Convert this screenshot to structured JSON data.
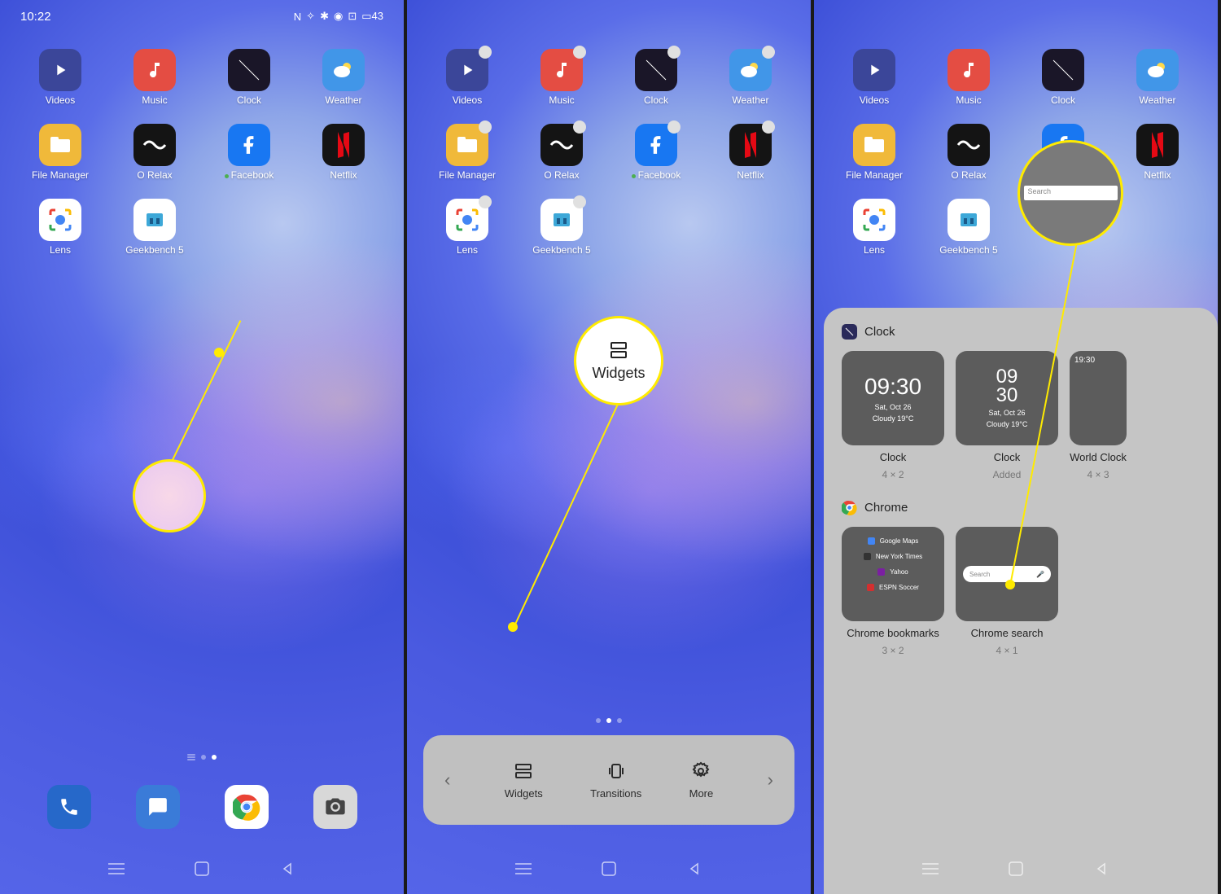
{
  "statusbar": {
    "time": "10:22",
    "battery": "43"
  },
  "apps": {
    "videos": "Videos",
    "music": "Music",
    "clock": "Clock",
    "weather": "Weather",
    "filemgr": "File Manager",
    "orelax": "O Relax",
    "facebook": "Facebook",
    "netflix": "Netflix",
    "lens": "Lens",
    "geekbench": "Geekbench 5"
  },
  "panel2": {
    "widgets_label": "Widgets",
    "transitions_label": "Transitions",
    "more_label": "More",
    "bubble_label": "Widgets"
  },
  "panel3": {
    "search_placeholder": "Search",
    "clock_section": "Clock",
    "chrome_section": "Chrome",
    "clock_widgets": [
      {
        "time": "09:30",
        "date": "Sat, Oct 26",
        "cond": "Cloudy 19°C",
        "label": "Clock",
        "size": "4 × 2"
      },
      {
        "time_a": "09",
        "time_b": "30",
        "date": "Sat, Oct 26",
        "cond": "Cloudy 19°C",
        "label": "Clock",
        "size": "Added"
      },
      {
        "time": "19:30",
        "label": "World Clock",
        "size": "4 × 3"
      }
    ],
    "chrome_widgets": [
      {
        "label": "Chrome bookmarks",
        "size": "3 × 2",
        "items": [
          "Google Maps",
          "New York Times",
          "Yahoo",
          "ESPN Soccer"
        ]
      },
      {
        "label": "Chrome search",
        "size": "4 × 1",
        "search": "Search"
      }
    ]
  }
}
